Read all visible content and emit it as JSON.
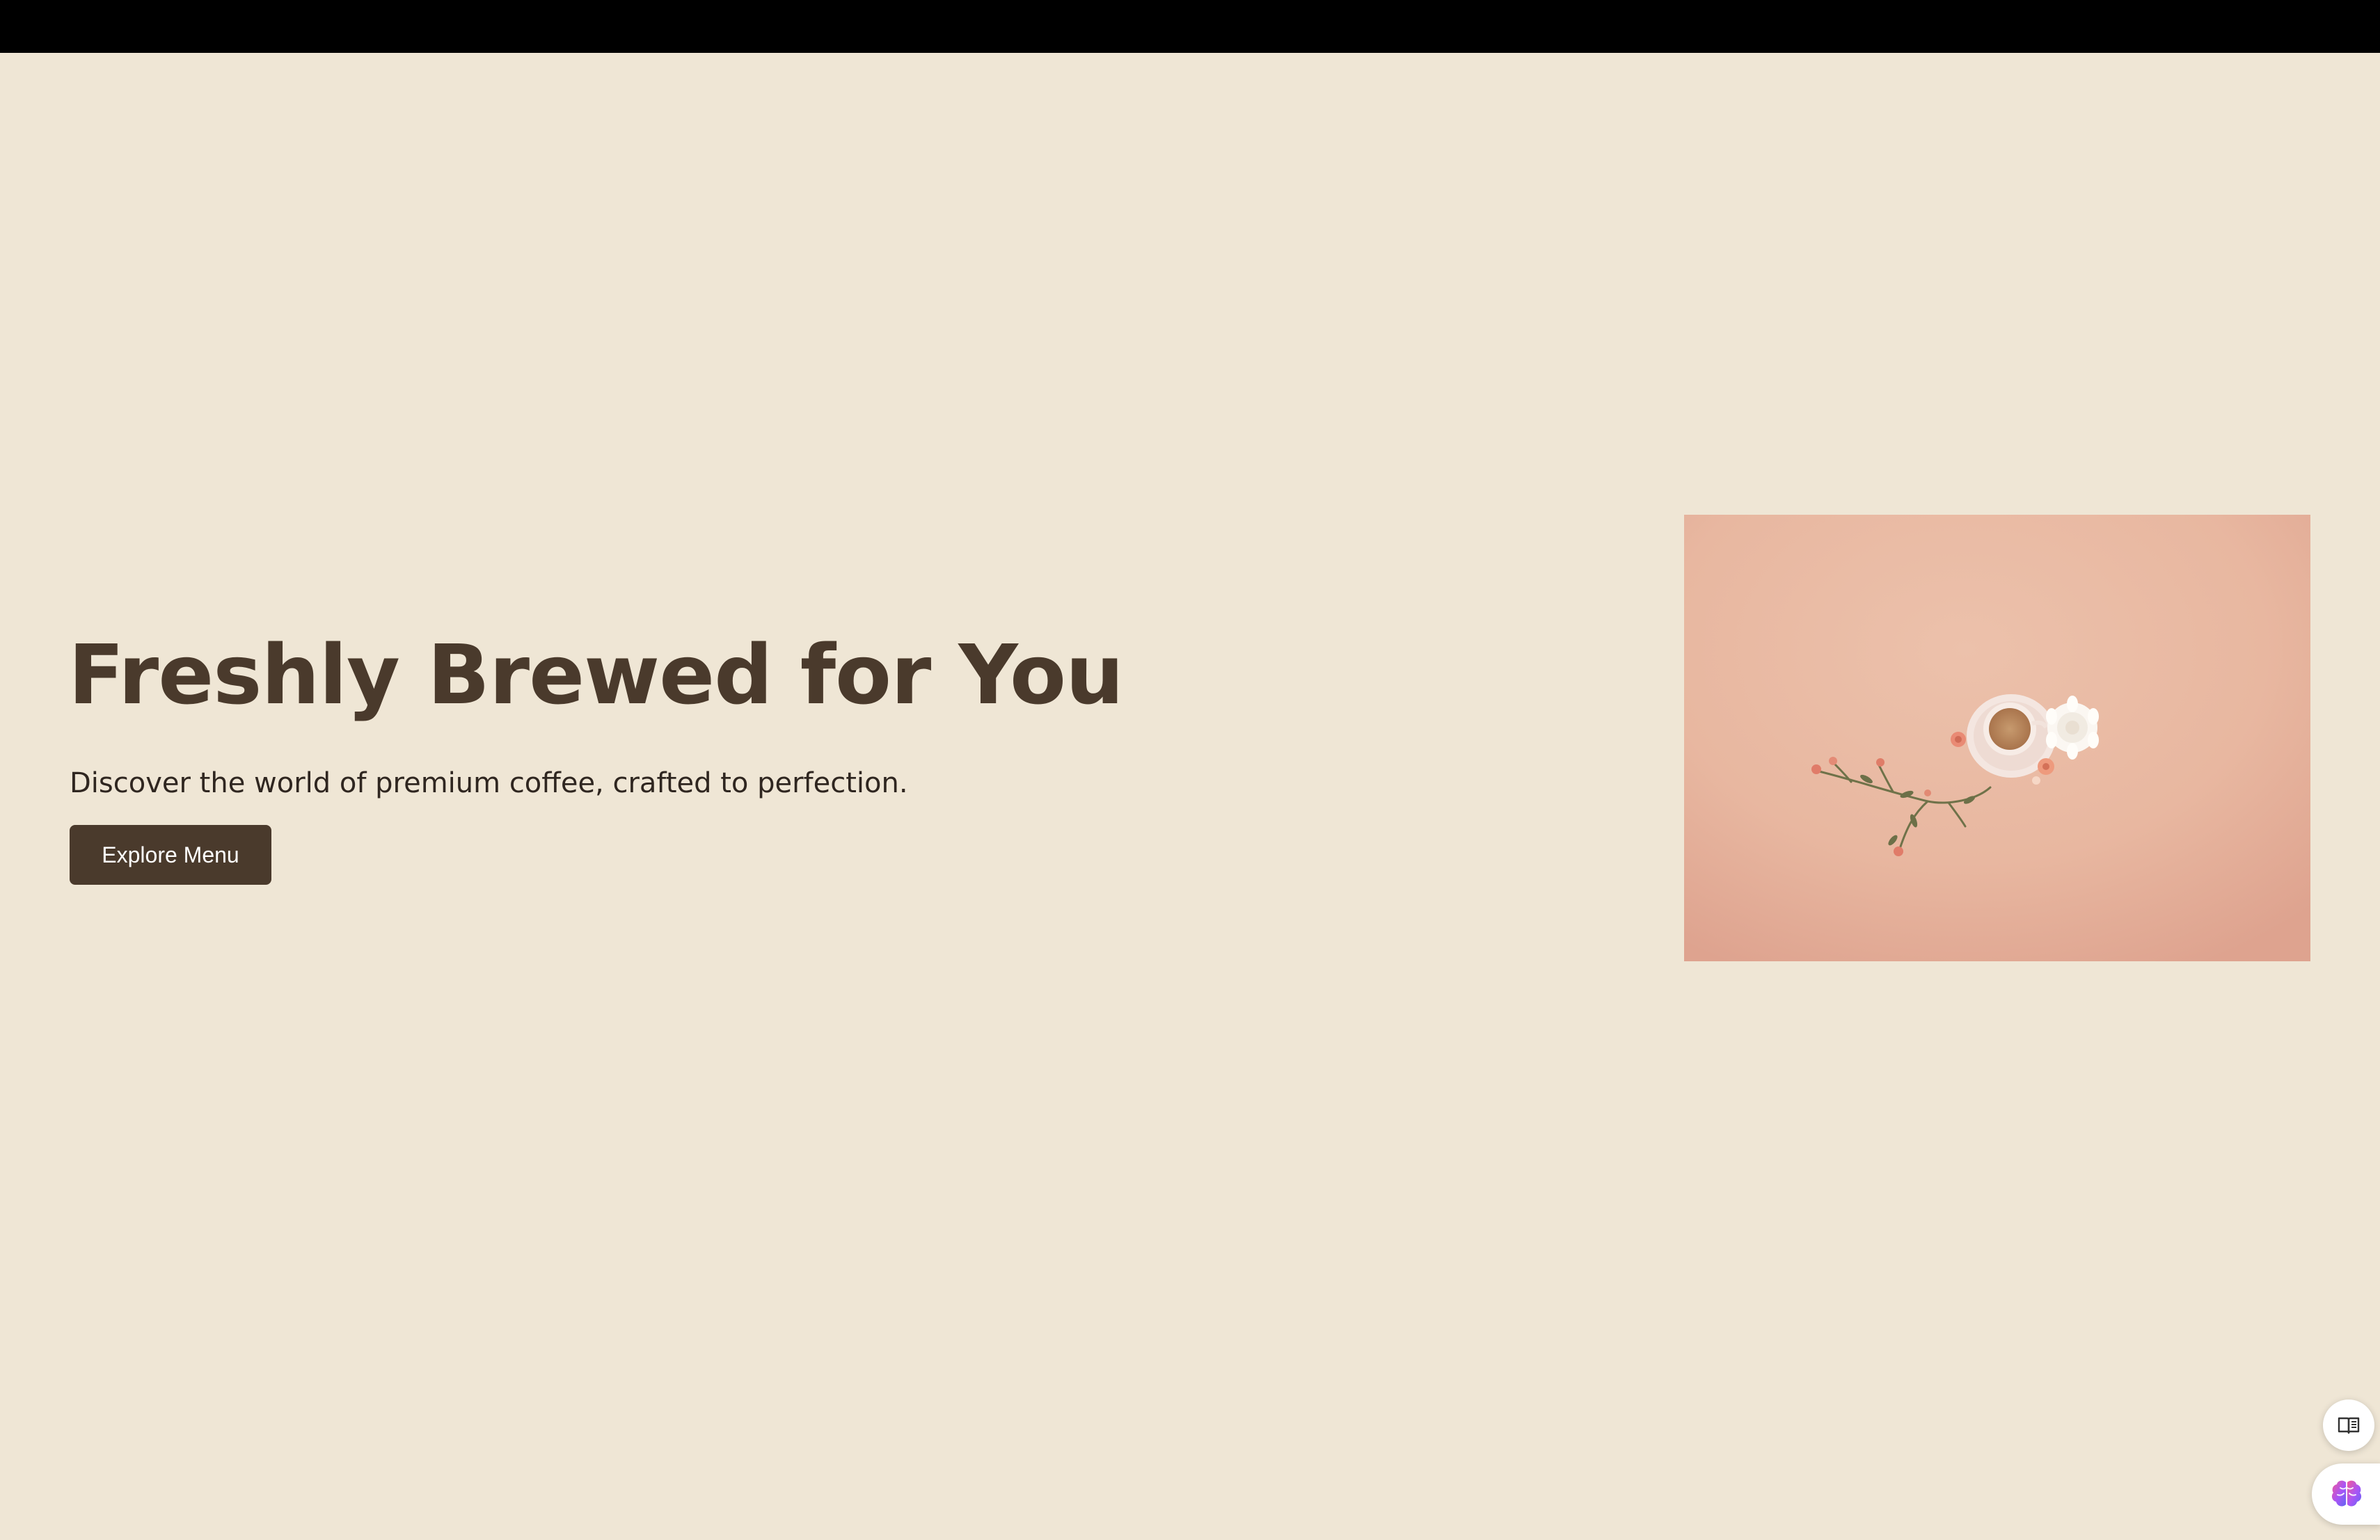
{
  "hero": {
    "title": "Freshly Brewed for You",
    "subtitle": "Discover the world of premium coffee, crafted to perfection.",
    "cta_label": "Explore Menu"
  },
  "colors": {
    "page_background": "#efe6d5",
    "top_bar": "#000000",
    "heading": "#4a3a2c",
    "button_background": "#4a3a2c",
    "button_text": "#ffffff",
    "image_background": "#e8b9a2"
  },
  "floating_buttons": [
    {
      "icon": "book-icon"
    },
    {
      "icon": "brain-icon"
    }
  ]
}
